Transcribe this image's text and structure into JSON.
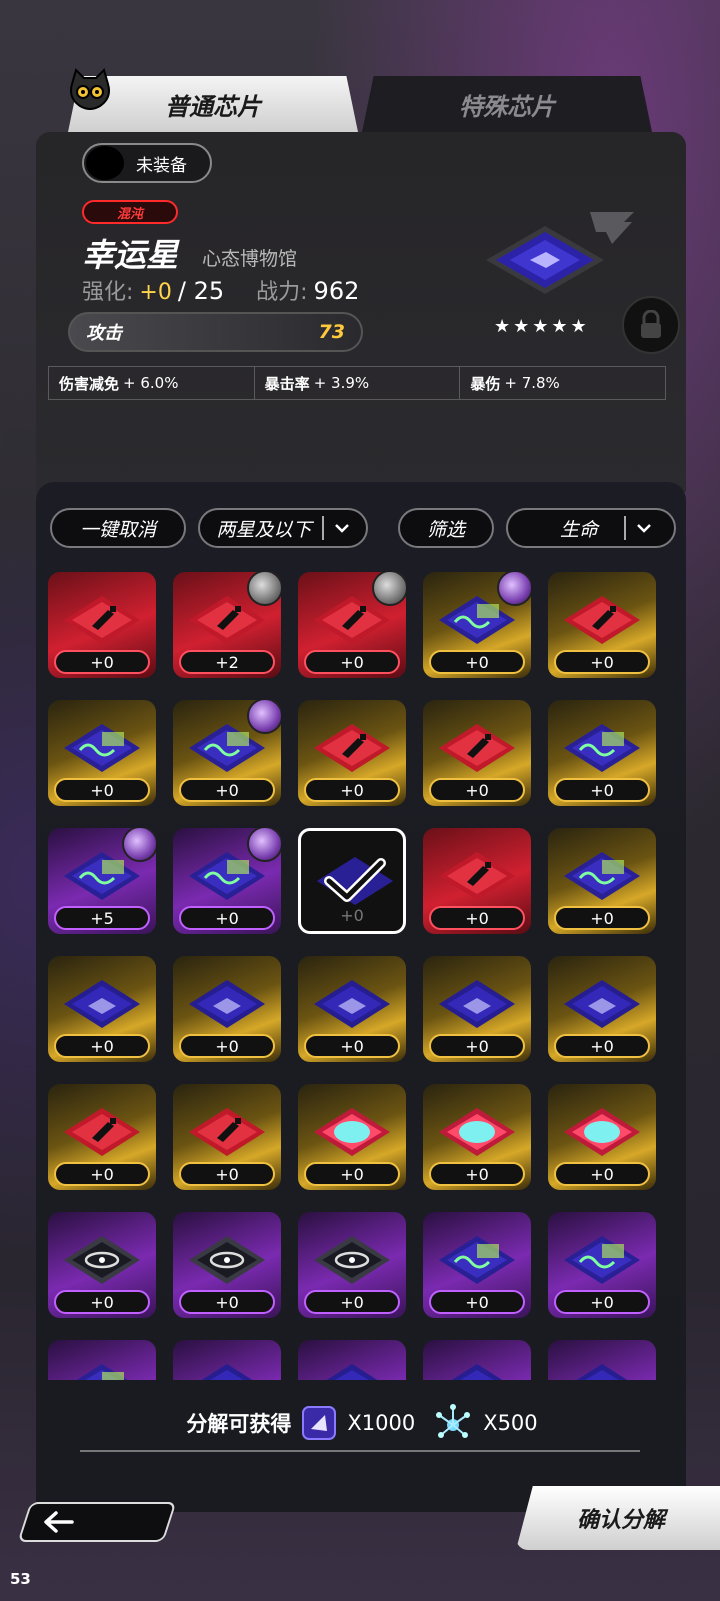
{
  "tabs": {
    "normal": "普通芯片",
    "special": "特殊芯片"
  },
  "equip": {
    "label": "未装备"
  },
  "chip": {
    "rarity_badge": "混沌",
    "name": "幸运星",
    "set": "心态博物馆",
    "enhance_label": "强化:",
    "enhance_value": "+0",
    "enhance_max": "/ 25",
    "power_label": "战力:",
    "power_value": "962",
    "stars": "★★★★★",
    "main_stat": {
      "name": "攻击",
      "value": "73"
    },
    "substats": [
      {
        "name": "伤害减免",
        "value": "+ 6.0%"
      },
      {
        "name": "暴击率",
        "value": "+ 3.9%"
      },
      {
        "name": "暴伤",
        "value": "+ 7.8%"
      }
    ]
  },
  "filters": {
    "cancel_all": "一键取消",
    "star_filter": "两星及以下",
    "filter": "筛选",
    "sort": "生命"
  },
  "tiles": [
    {
      "color": "red",
      "icon": "bottle",
      "level": "+0",
      "badge": null
    },
    {
      "color": "red",
      "icon": "bottle",
      "level": "+2",
      "badge": "grey"
    },
    {
      "color": "red",
      "icon": "bottle",
      "level": "+0",
      "badge": "grey"
    },
    {
      "color": "gold",
      "icon": "wave",
      "level": "+0",
      "badge": "purple"
    },
    {
      "color": "gold",
      "icon": "bottle",
      "level": "+0",
      "badge": null
    },
    {
      "color": "gold",
      "icon": "wave",
      "level": "+0",
      "badge": null
    },
    {
      "color": "gold",
      "icon": "wave",
      "level": "+0",
      "badge": "purple"
    },
    {
      "color": "gold",
      "icon": "bottle",
      "level": "+0",
      "badge": null
    },
    {
      "color": "gold",
      "icon": "bottle",
      "level": "+0",
      "badge": null
    },
    {
      "color": "gold",
      "icon": "wave",
      "level": "+0",
      "badge": null
    },
    {
      "color": "purple",
      "icon": "wave",
      "level": "+5",
      "badge": "purple"
    },
    {
      "color": "purple",
      "icon": "wave",
      "level": "+0",
      "badge": "purple"
    },
    {
      "color": "selected",
      "icon": "check",
      "level": "+0",
      "badge": null
    },
    {
      "color": "red",
      "icon": "bottle",
      "level": "+0",
      "badge": null
    },
    {
      "color": "gold",
      "icon": "wave",
      "level": "+0",
      "badge": null
    },
    {
      "color": "gold",
      "icon": "logo",
      "level": "+0",
      "badge": null
    },
    {
      "color": "gold",
      "icon": "logo",
      "level": "+0",
      "badge": null
    },
    {
      "color": "gold",
      "icon": "logo",
      "level": "+0",
      "badge": null
    },
    {
      "color": "gold",
      "icon": "logo",
      "level": "+0",
      "badge": null
    },
    {
      "color": "gold",
      "icon": "logo",
      "level": "+0",
      "badge": null
    },
    {
      "color": "gold",
      "icon": "bottle",
      "level": "+0",
      "badge": null
    },
    {
      "color": "gold",
      "icon": "bottle",
      "level": "+0",
      "badge": null
    },
    {
      "color": "gold",
      "icon": "brain",
      "level": "+0",
      "badge": null
    },
    {
      "color": "gold",
      "icon": "brain",
      "level": "+0",
      "badge": null
    },
    {
      "color": "gold",
      "icon": "brain",
      "level": "+0",
      "badge": null
    },
    {
      "color": "purple",
      "icon": "swirl",
      "level": "+0",
      "badge": null
    },
    {
      "color": "purple",
      "icon": "swirl",
      "level": "+0",
      "badge": null
    },
    {
      "color": "purple",
      "icon": "swirl",
      "level": "+0",
      "badge": null
    },
    {
      "color": "purple",
      "icon": "wave",
      "level": "+0",
      "badge": null
    },
    {
      "color": "purple",
      "icon": "wave",
      "level": "+0",
      "badge": null
    },
    {
      "color": "purple",
      "icon": "wave",
      "level": "",
      "badge": null
    },
    {
      "color": "purple",
      "icon": "logo",
      "level": "",
      "badge": null
    },
    {
      "color": "purple",
      "icon": "logo",
      "level": "",
      "badge": null
    },
    {
      "color": "purple",
      "icon": "logo",
      "level": "",
      "badge": null
    },
    {
      "color": "purple",
      "icon": "logo",
      "level": "",
      "badge": null
    }
  ],
  "rewards": {
    "label": "分解可获得",
    "item1": "X1000",
    "item2": "X500"
  },
  "confirm": "确认分解",
  "fps": "53"
}
